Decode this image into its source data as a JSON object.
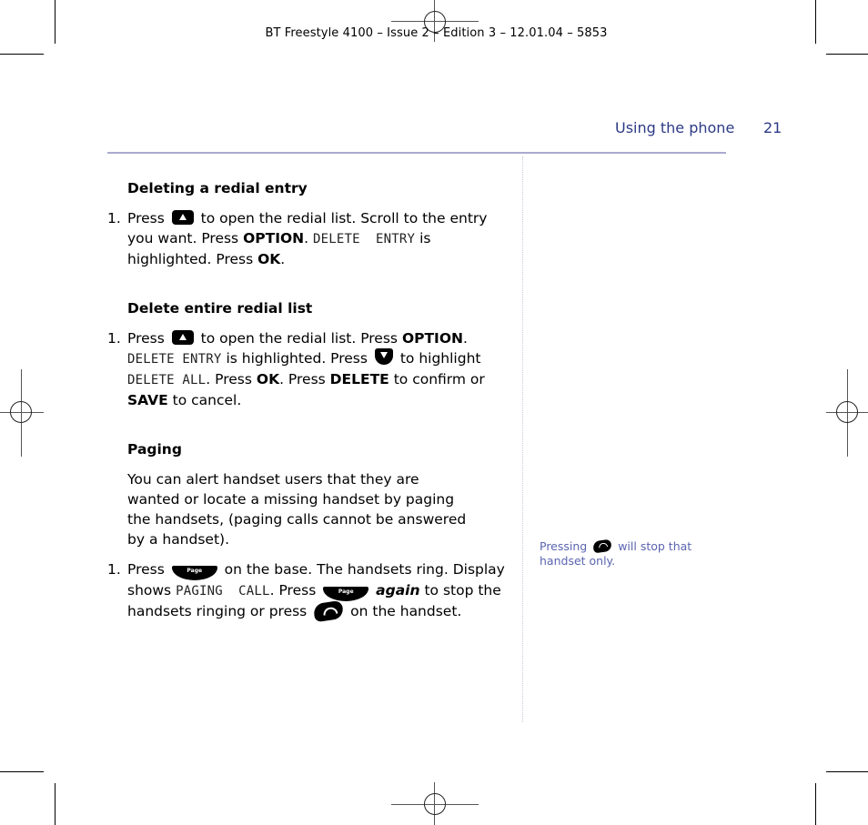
{
  "slug": "BT Freestyle 4100 – Issue 2 – Edition 3 – 12.01.04 – 5853",
  "header": {
    "section_title": "Using the phone",
    "page_number": "21"
  },
  "colors": {
    "accent": "#2c3a85",
    "rule": "#aaaad0",
    "sidenote": "#5a64b0"
  },
  "sections": [
    {
      "heading": "Deleting a redial entry",
      "steps": [
        {
          "number": "1.",
          "parts": {
            "t1": "Press",
            "icon": "up-arrow-key",
            "t2": "to open the redial list. Scroll to the entry you want. Press",
            "b1": "OPTION",
            "t3": ".",
            "d1": "DELETE  ENTRY",
            "t4": "is highlighted. Press",
            "b2": "OK",
            "t5": "."
          }
        }
      ]
    },
    {
      "heading": "Delete entire redial list",
      "steps": [
        {
          "number": "1.",
          "parts": {
            "t1": "Press",
            "icon1": "up-arrow-key",
            "t2": "to open the redial list. Press",
            "b1": "OPTION",
            "t3": ".",
            "d1": "DELETE ENTRY",
            "t4": "is highlighted. Press",
            "icon2": "down-arrow-key",
            "t5": "to highlight",
            "d2": "DELETE ALL",
            "t6": ". Press",
            "b2": "OK",
            "t7": ". Press",
            "b3": "DELETE",
            "t8": "to confirm or",
            "b4": "SAVE",
            "t9": "to cancel."
          }
        }
      ]
    },
    {
      "heading": "Paging",
      "intro": "You can alert handset users that they are wanted or locate a missing handset by paging the handsets, (paging calls cannot be answered by a handset).",
      "steps": [
        {
          "number": "1.",
          "parts": {
            "t1": "Press",
            "icon1": "page-key",
            "icon1_label": "Page",
            "t2": "on the base. The handsets ring. Display shows",
            "d1": "PAGING  CALL",
            "t3": ". Press",
            "icon2": "page-key",
            "icon2_label": "Page",
            "i1": "again",
            "t4": "to stop the handsets ringing or press",
            "icon3": "end-call-key",
            "t5": "on the handset."
          }
        }
      ]
    }
  ],
  "sidenote": {
    "t1": "Pressing",
    "icon": "end-call-key",
    "t2": "will stop that handset only."
  }
}
